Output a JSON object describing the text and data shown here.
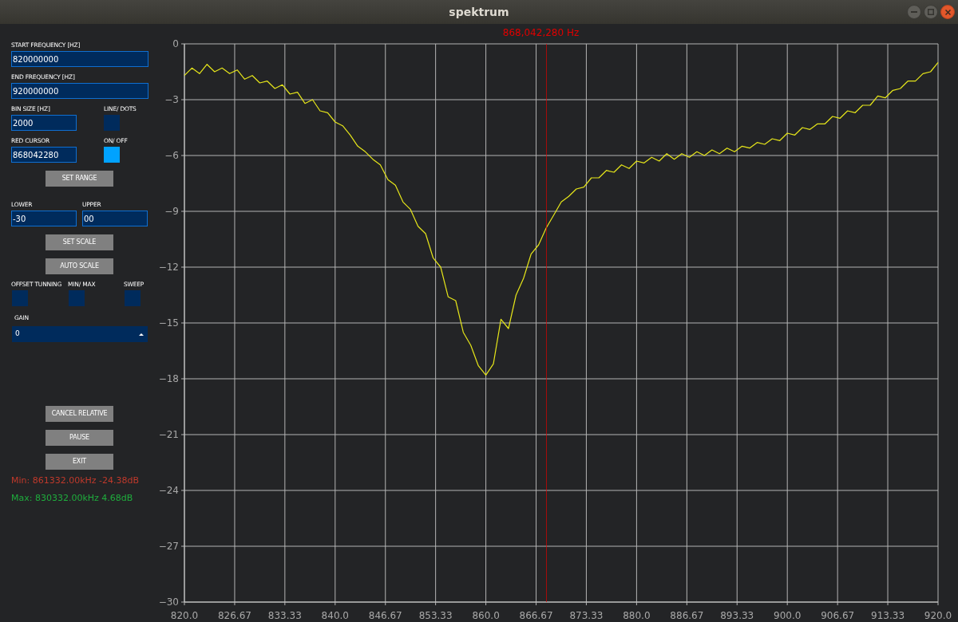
{
  "window": {
    "title": "spektrum"
  },
  "panel": {
    "start_frequency": {
      "label": "START FREQUENCY [HZ]",
      "value": "820000000"
    },
    "end_frequency": {
      "label": "END FREQUENCY [HZ]",
      "value": "920000000"
    },
    "bin_size": {
      "label": "BIN SIZE [HZ]",
      "value": "2000"
    },
    "line_dots": {
      "label": "LINE/ DOTS",
      "on": false
    },
    "red_cursor": {
      "label": "RED CURSOR",
      "value": "868042280"
    },
    "cursor_on_off": {
      "label": "ON/ OFF",
      "on": true
    },
    "set_range_button": "SET RANGE",
    "lower": {
      "label": "LOWER",
      "value": "-30"
    },
    "upper": {
      "label": "UPPER",
      "value": "00"
    },
    "set_scale_button": "SET SCALE",
    "auto_scale_button": "AUTO SCALE",
    "toggles": [
      {
        "label": "OFFSET TUNNING",
        "on": false
      },
      {
        "label": "MIN/ MAX",
        "on": false
      },
      {
        "label": "SWEEP",
        "on": false
      }
    ],
    "gain": {
      "label": "GAIN",
      "value": "0"
    },
    "buttons": [
      "CANCEL RELATIVE",
      "PAUSE",
      "EXIT"
    ],
    "min_readout": "Min: 861332.00kHz -24.38dB",
    "max_readout": "Max: 830332.00kHz 4.68dB"
  },
  "spectrum_plot": {
    "chart_data": [
      {
        "type": "line",
        "color": "#e6e61a",
        "grid": true,
        "xlim": [
          820,
          920
        ],
        "ylim": [
          -30,
          0
        ],
        "xticks": [
          {
            "value": 820,
            "label": "820.0"
          },
          {
            "value": 826.67,
            "label": "826.67"
          },
          {
            "value": 833.33,
            "label": "833.33"
          },
          {
            "value": 840,
            "label": "840.0"
          },
          {
            "value": 846.67,
            "label": "846.67"
          },
          {
            "value": 853.33,
            "label": "853.33"
          },
          {
            "value": 860,
            "label": "860.0"
          },
          {
            "value": 866.67,
            "label": "866.67"
          },
          {
            "value": 873.33,
            "label": "873.33"
          },
          {
            "value": 880,
            "label": "880.0"
          },
          {
            "value": 886.67,
            "label": "886.67"
          },
          {
            "value": 893.33,
            "label": "893.33"
          },
          {
            "value": 900,
            "label": "900.0"
          },
          {
            "value": 906.67,
            "label": "906.67"
          },
          {
            "value": 913.33,
            "label": "913.33"
          },
          {
            "value": 920,
            "label": "920.0"
          }
        ],
        "yticks": [
          {
            "value": 0,
            "label": "0"
          },
          {
            "value": -3,
            "label": "−3"
          },
          {
            "value": -6,
            "label": "−6"
          },
          {
            "value": -9,
            "label": "−9"
          },
          {
            "value": -12,
            "label": "−12"
          },
          {
            "value": -15,
            "label": "−15"
          },
          {
            "value": -18,
            "label": "−18"
          },
          {
            "value": -21,
            "label": "−21"
          },
          {
            "value": -24,
            "label": "−24"
          },
          {
            "value": -27,
            "label": "−27"
          },
          {
            "value": -30,
            "label": "−30"
          }
        ],
        "ref_lines": [
          {
            "axis": "x",
            "value": 868.04228,
            "label": "868,042,280 Hz",
            "color": "#e00000"
          }
        ],
        "x": [
          820,
          821,
          822,
          823,
          824,
          825,
          826,
          827,
          828,
          829,
          830,
          831,
          832,
          833,
          834,
          835,
          836,
          837,
          838,
          839,
          840,
          841,
          842,
          843,
          844,
          845,
          846,
          847,
          848,
          849,
          850,
          851,
          852,
          853,
          854,
          855,
          856,
          857,
          858,
          859,
          860,
          861,
          862,
          863,
          864,
          865,
          866,
          867,
          868,
          869,
          870,
          871,
          872,
          873,
          874,
          875,
          876,
          877,
          878,
          879,
          880,
          881,
          882,
          883,
          884,
          885,
          886,
          887,
          888,
          889,
          890,
          891,
          892,
          893,
          894,
          895,
          896,
          897,
          898,
          899,
          900,
          901,
          902,
          903,
          904,
          905,
          906,
          907,
          908,
          909,
          910,
          911,
          912,
          913,
          914,
          915,
          916,
          917,
          918,
          919,
          920
        ],
        "values": [
          -1.7,
          -1.3,
          -1.6,
          -1.1,
          -1.5,
          -1.3,
          -1.6,
          -1.4,
          -1.9,
          -1.7,
          -2.1,
          -2.0,
          -2.4,
          -2.2,
          -2.7,
          -2.6,
          -3.2,
          -3.0,
          -3.6,
          -3.7,
          -4.2,
          -4.4,
          -4.9,
          -5.5,
          -5.8,
          -6.2,
          -6.5,
          -7.3,
          -7.6,
          -8.5,
          -8.9,
          -9.8,
          -10.2,
          -11.5,
          -12.0,
          -13.6,
          -13.8,
          -15.5,
          -16.2,
          -17.3,
          -17.8,
          -17.2,
          -14.8,
          -15.3,
          -13.5,
          -12.6,
          -11.3,
          -10.8,
          -9.9,
          -9.2,
          -8.5,
          -8.2,
          -7.8,
          -7.7,
          -7.2,
          -7.2,
          -6.8,
          -6.9,
          -6.5,
          -6.7,
          -6.3,
          -6.4,
          -6.1,
          -6.3,
          -5.9,
          -6.2,
          -5.9,
          -6.1,
          -5.8,
          -6.0,
          -5.7,
          -5.9,
          -5.6,
          -5.8,
          -5.5,
          -5.6,
          -5.3,
          -5.4,
          -5.1,
          -5.2,
          -4.8,
          -4.9,
          -4.5,
          -4.6,
          -4.3,
          -4.3,
          -3.9,
          -4.0,
          -3.6,
          -3.7,
          -3.3,
          -3.3,
          -2.8,
          -2.9,
          -2.5,
          -2.4,
          -2.0,
          -2.0,
          -1.6,
          -1.5,
          -1.0
        ]
      }
    ]
  }
}
